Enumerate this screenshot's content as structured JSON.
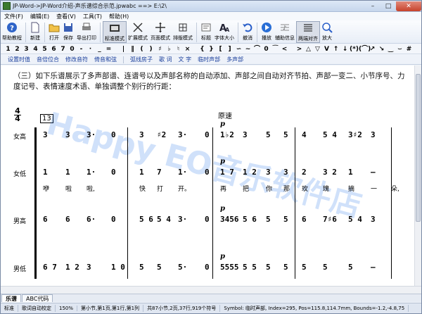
{
  "window": {
    "title": "JP-Word->JP-Word介绍-声乐谱综合示范.jpwabc ==> E:\\2\\",
    "min": "–",
    "max": "□",
    "close": "✕"
  },
  "menu": [
    "文件(F)",
    "编辑(E)",
    "查看(V)",
    "工具(T)",
    "帮助(H)"
  ],
  "toolbar": [
    {
      "id": "help",
      "label": "帮助教程",
      "icon": "help-icon"
    },
    {
      "id": "new",
      "label": "新建",
      "icon": "new-file-icon"
    },
    {
      "id": "open",
      "label": "打开",
      "icon": "open-folder-icon"
    },
    {
      "id": "save",
      "label": "保存",
      "icon": "save-icon"
    },
    {
      "id": "export",
      "label": "导出打印",
      "icon": "print-icon"
    },
    {
      "id": "std",
      "label": "标准模式",
      "icon": "standard-mode-icon",
      "active": true
    },
    {
      "id": "expand",
      "label": "扩展模式",
      "icon": "expand-mode-icon"
    },
    {
      "id": "page",
      "label": "页面模式",
      "icon": "page-mode-icon"
    },
    {
      "id": "layout",
      "label": "排版模式",
      "icon": "layout-mode-icon"
    },
    {
      "id": "heading",
      "label": "标题",
      "icon": "heading-icon"
    },
    {
      "id": "font",
      "label": "字体大小",
      "icon": "font-size-icon"
    },
    {
      "id": "undo",
      "label": "撤消",
      "icon": "undo-icon"
    },
    {
      "id": "play",
      "label": "播放",
      "icon": "play-icon"
    },
    {
      "id": "aux",
      "label": "辅助信息",
      "icon": "aux-info-icon"
    },
    {
      "id": "align",
      "label": "两端对齐",
      "icon": "align-both-icon",
      "active": true
    },
    {
      "id": "zoom",
      "label": "放大",
      "icon": "zoom-in-icon"
    }
  ],
  "symbols": [
    "1",
    "2",
    "3",
    "4",
    "5",
    "6",
    "7",
    "0",
    "-",
    "·",
    "_",
    "=",
    "|",
    "‖",
    "(",
    ")",
    "♯",
    "♭",
    "♮",
    "×",
    "{",
    "}",
    "[",
    "]",
    "∽",
    "~",
    "⌒",
    "0",
    "⁀",
    "<",
    ">",
    "△",
    "▽",
    "V",
    "↑",
    "↓",
    "(*)",
    "(⌒)",
    "↗",
    "↘",
    "‿",
    "⌣",
    "#"
  ],
  "commands": [
    "设置时值",
    "音倍位合",
    "修改音符",
    "倚音和弦",
    "弧线房子",
    "歌 词",
    "文 字",
    "临时声部",
    "多声部"
  ],
  "content": {
    "intro": "（三）如下乐谱展示了多声部谱、连谱号以及声部名称的自动添加、声部之间自动对齐节拍、声部一变二、小节序号、力度记号、表情速度术语、单独调整个别行的行距：",
    "time_sig_top": "4",
    "time_sig_bottom": "4",
    "measure_no": "13",
    "tempo": "原速",
    "dynamic": "p",
    "parts": [
      {
        "name": "女高",
        "notes": [
          "3",
          "3",
          "3·",
          "0",
          "3",
          "♯2",
          "3·",
          "0",
          "1♭2",
          "3",
          "5",
          "5",
          "4",
          "5 4",
          "3♯2",
          "3"
        ]
      },
      {
        "name": "女低",
        "notes": [
          "1",
          "1",
          "1·",
          "0",
          "1",
          "7",
          "1·",
          "0",
          "1 7",
          "1 2",
          "3",
          "3",
          "2",
          "3 2",
          "1",
          "–"
        ]
      },
      {
        "name": "男高",
        "notes": [
          "6",
          "6",
          "6·",
          "0",
          "5 6",
          "5 4",
          "3·",
          "0",
          "3456",
          "5 6",
          "5",
          "5",
          "6",
          "7♯6",
          "5 4",
          "3"
        ]
      },
      {
        "name": "男低",
        "notes": [
          "6 7",
          "1 2",
          "3",
          "1 0",
          "5",
          "5",
          "5·",
          "0",
          "5555",
          "5 5",
          "5",
          "5",
          "5",
          "5",
          "5",
          "–"
        ]
      }
    ],
    "lyrics": [
      "咿",
      "啦",
      "啦,",
      "快",
      "打",
      "开。",
      "再",
      "把",
      "你",
      "那",
      "玫",
      "瑰",
      "摘",
      "一",
      "朵,"
    ],
    "watermark": "Happy EO音乐软件店"
  },
  "tabs": [
    "乐谱",
    "ABC代码"
  ],
  "status": [
    "标准",
    "歌词自动校定",
    "150%",
    "第小节,第1页,第1行,第1列",
    "共87小节,2页,37行,919个符号",
    "Symbol: 临时声部, Index=295, Pos=115.8,114.7mm, Bounds=-1.2,-4.8,75"
  ]
}
